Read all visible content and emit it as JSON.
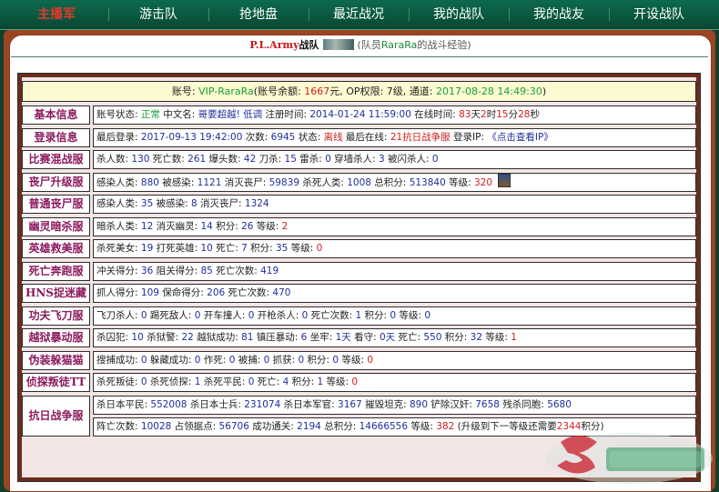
{
  "nav": {
    "items": [
      "主播军",
      "游击队",
      "抢地盘",
      "最近战况",
      "我的战队",
      "我的战友",
      "开设战队"
    ]
  },
  "title": {
    "team_name": "P.L.Army",
    "zhan_dui": "战队",
    "sub_prefix": "(队员",
    "member": "RaraRa",
    "sub_suffix": "的战斗经验)"
  },
  "account": {
    "prefix": "账号: ",
    "name": "VIP-RaraRa",
    "balance_label": "(账号余额: ",
    "balance": "1667",
    "balance_unit": "元, OP权限: ",
    "op_level": "7级",
    "channel_label": ", 通道: ",
    "datetime": "2017-08-28 14:49:30",
    "close": ")"
  },
  "rows": [
    {
      "label": "基本信息",
      "segs": [
        {
          "t": "账号状态: "
        },
        {
          "t": "正常",
          "c": "g"
        },
        {
          "t": "  中文名: "
        },
        {
          "t": "哥要超越! 低调",
          "c": "b"
        },
        {
          "t": " 注册时间: "
        },
        {
          "t": "2014-01-24 11:59:00",
          "c": "v"
        },
        {
          "t": "  在线时间: "
        },
        {
          "t": "83",
          "c": "r"
        },
        {
          "t": "天"
        },
        {
          "t": "2",
          "c": "r"
        },
        {
          "t": "时"
        },
        {
          "t": "15",
          "c": "r"
        },
        {
          "t": "分"
        },
        {
          "t": "28",
          "c": "r"
        },
        {
          "t": "秒"
        }
      ]
    },
    {
      "label": "登录信息",
      "segs": [
        {
          "t": "最后登录: "
        },
        {
          "t": "2017-09-13 19:42:00",
          "c": "v"
        },
        {
          "t": " 次数: "
        },
        {
          "t": "6945",
          "c": "v"
        },
        {
          "t": " 状态: "
        },
        {
          "t": "离线",
          "c": "r"
        },
        {
          "t": " 最后在线: "
        },
        {
          "t": "21抗日战争服",
          "c": "r"
        },
        {
          "t": " 登录IP: "
        },
        {
          "t": "《点击查看IP》",
          "c": "b"
        }
      ]
    },
    {
      "label": "比赛混战服",
      "segs": [
        {
          "t": "杀人数: "
        },
        {
          "t": "130",
          "c": "v"
        },
        {
          "t": " 死亡数: "
        },
        {
          "t": "261",
          "c": "v"
        },
        {
          "t": " 爆头数: "
        },
        {
          "t": "42",
          "c": "v"
        },
        {
          "t": " 刀杀: "
        },
        {
          "t": "15",
          "c": "v"
        },
        {
          "t": " 雷杀: "
        },
        {
          "t": "0",
          "c": "v"
        },
        {
          "t": " 穿墙杀人: "
        },
        {
          "t": "3",
          "c": "v"
        },
        {
          "t": " 被闪杀人: "
        },
        {
          "t": "0",
          "c": "v"
        }
      ]
    },
    {
      "label": "丧尸升级服",
      "segs": [
        {
          "t": "感染人类: "
        },
        {
          "t": "880",
          "c": "v"
        },
        {
          "t": " 被感染: "
        },
        {
          "t": "1121",
          "c": "v"
        },
        {
          "t": " 消灭丧尸: "
        },
        {
          "t": "59839",
          "c": "v"
        },
        {
          "t": " 杀死人类: "
        },
        {
          "t": "1008",
          "c": "v"
        },
        {
          "t": " 总积分: "
        },
        {
          "t": "513840",
          "c": "v"
        },
        {
          "t": " 等级: "
        },
        {
          "t": "320",
          "c": "r"
        }
      ],
      "badge": true
    },
    {
      "label": "普通丧尸服",
      "segs": [
        {
          "t": "感染人类: "
        },
        {
          "t": "35",
          "c": "v"
        },
        {
          "t": " 被感染: "
        },
        {
          "t": "8",
          "c": "v"
        },
        {
          "t": " 消灭丧尸: "
        },
        {
          "t": "1324",
          "c": "v"
        }
      ]
    },
    {
      "label": "幽灵暗杀服",
      "segs": [
        {
          "t": "暗杀人类: "
        },
        {
          "t": "12",
          "c": "v"
        },
        {
          "t": " 消灭幽灵: "
        },
        {
          "t": "14",
          "c": "v"
        },
        {
          "t": " 积分: "
        },
        {
          "t": "26",
          "c": "v"
        },
        {
          "t": " 等级: "
        },
        {
          "t": "2",
          "c": "r"
        }
      ]
    },
    {
      "label": "英雄救美服",
      "segs": [
        {
          "t": "杀死美女: "
        },
        {
          "t": "19",
          "c": "v"
        },
        {
          "t": " 打死英雄: "
        },
        {
          "t": "10",
          "c": "v"
        },
        {
          "t": " 死亡: "
        },
        {
          "t": "7",
          "c": "v"
        },
        {
          "t": " 积分: "
        },
        {
          "t": "35",
          "c": "v"
        },
        {
          "t": " 等级: "
        },
        {
          "t": "0",
          "c": "r"
        }
      ]
    },
    {
      "label": "死亡奔跑服",
      "segs": [
        {
          "t": "冲关得分: "
        },
        {
          "t": "36",
          "c": "v"
        },
        {
          "t": " 阻关得分: "
        },
        {
          "t": "85",
          "c": "v"
        },
        {
          "t": " 死亡次数: "
        },
        {
          "t": "419",
          "c": "v"
        }
      ]
    },
    {
      "label": "HNS捉迷藏",
      "segs": [
        {
          "t": "抓人得分: "
        },
        {
          "t": "109",
          "c": "v"
        },
        {
          "t": " 保命得分: "
        },
        {
          "t": "206",
          "c": "v"
        },
        {
          "t": " 死亡次数: "
        },
        {
          "t": "470",
          "c": "v"
        }
      ]
    },
    {
      "label": "功夫飞刀服",
      "segs": [
        {
          "t": "飞刀杀人: "
        },
        {
          "t": "0",
          "c": "v"
        },
        {
          "t": " 踢死敌人: "
        },
        {
          "t": "0",
          "c": "v"
        },
        {
          "t": " 开车撞人: "
        },
        {
          "t": "0",
          "c": "v"
        },
        {
          "t": " 开枪杀人: "
        },
        {
          "t": "0",
          "c": "v"
        },
        {
          "t": " 死亡次数: "
        },
        {
          "t": "1",
          "c": "v"
        },
        {
          "t": " 积分: "
        },
        {
          "t": "0",
          "c": "v"
        },
        {
          "t": " 等级: "
        },
        {
          "t": "0",
          "c": "v"
        }
      ]
    },
    {
      "label": "越狱暴动服",
      "segs": [
        {
          "t": "杀囚犯: "
        },
        {
          "t": "10",
          "c": "v"
        },
        {
          "t": " 杀狱警: "
        },
        {
          "t": "22",
          "c": "v"
        },
        {
          "t": " 越狱成功: "
        },
        {
          "t": "81",
          "c": "v"
        },
        {
          "t": " 镇压暴动: "
        },
        {
          "t": "6",
          "c": "v"
        },
        {
          "t": " 坐牢: "
        },
        {
          "t": "1天",
          "c": "v"
        },
        {
          "t": " 看守: "
        },
        {
          "t": "0天",
          "c": "v"
        },
        {
          "t": " 死亡: "
        },
        {
          "t": "550",
          "c": "v"
        },
        {
          "t": " 积分: "
        },
        {
          "t": "32",
          "c": "v"
        },
        {
          "t": " 等级: "
        },
        {
          "t": "1",
          "c": "r"
        }
      ]
    },
    {
      "label": "伪装躲猫猫",
      "segs": [
        {
          "t": "搜捕成功: "
        },
        {
          "t": "0",
          "c": "v"
        },
        {
          "t": " 躲藏成功: "
        },
        {
          "t": "0",
          "c": "v"
        },
        {
          "t": " 作死: "
        },
        {
          "t": "0",
          "c": "v"
        },
        {
          "t": " 被捕: "
        },
        {
          "t": "0",
          "c": "v"
        },
        {
          "t": " 抓获: "
        },
        {
          "t": "0",
          "c": "v"
        },
        {
          "t": " 积分: "
        },
        {
          "t": "0",
          "c": "v"
        },
        {
          "t": " 等级: "
        },
        {
          "t": "0",
          "c": "r"
        }
      ]
    },
    {
      "label": "侦探叛徒TT",
      "segs": [
        {
          "t": "杀死叛徒: "
        },
        {
          "t": "0",
          "c": "v"
        },
        {
          "t": " 杀死侦探: "
        },
        {
          "t": "1",
          "c": "v"
        },
        {
          "t": " 杀死平民: "
        },
        {
          "t": "0",
          "c": "v"
        },
        {
          "t": " 死亡: "
        },
        {
          "t": "4",
          "c": "v"
        },
        {
          "t": " 积分: "
        },
        {
          "t": "1",
          "c": "v"
        },
        {
          "t": " 等级: "
        },
        {
          "t": "0",
          "c": "r"
        }
      ]
    }
  ],
  "war_row": {
    "label": "抗日战争服",
    "line1": [
      {
        "t": "杀日本平民: "
      },
      {
        "t": "552008",
        "c": "v"
      },
      {
        "t": " 杀日本士兵: "
      },
      {
        "t": "231074",
        "c": "v"
      },
      {
        "t": " 杀日本军官: "
      },
      {
        "t": "3167",
        "c": "v"
      },
      {
        "t": " 摧毁坦克: "
      },
      {
        "t": "890",
        "c": "v"
      },
      {
        "t": " 铲除汉奸: "
      },
      {
        "t": "7658",
        "c": "v"
      },
      {
        "t": " 残杀同胞: "
      },
      {
        "t": "5680",
        "c": "v"
      }
    ],
    "line2": [
      {
        "t": "阵亡次数: "
      },
      {
        "t": "10028",
        "c": "v"
      },
      {
        "t": " 占领据点: "
      },
      {
        "t": "56706",
        "c": "v"
      },
      {
        "t": " 成功通关: "
      },
      {
        "t": "2194",
        "c": "v"
      },
      {
        "t": " 总积分: "
      },
      {
        "t": "14666556",
        "c": "v"
      },
      {
        "t": " 等级: "
      },
      {
        "t": "382",
        "c": "r"
      },
      {
        "t": " (升级到下一等级还需要"
      },
      {
        "t": "2344",
        "c": "r"
      },
      {
        "t": "积分)"
      }
    ]
  },
  "colors": {
    "nav_bg": "#0a5840",
    "frame": "#9b4524",
    "label_text": "#8b1a5e",
    "value": "#1f2f9a",
    "highlight": "#d01f1f",
    "ok": "#18a03a"
  }
}
